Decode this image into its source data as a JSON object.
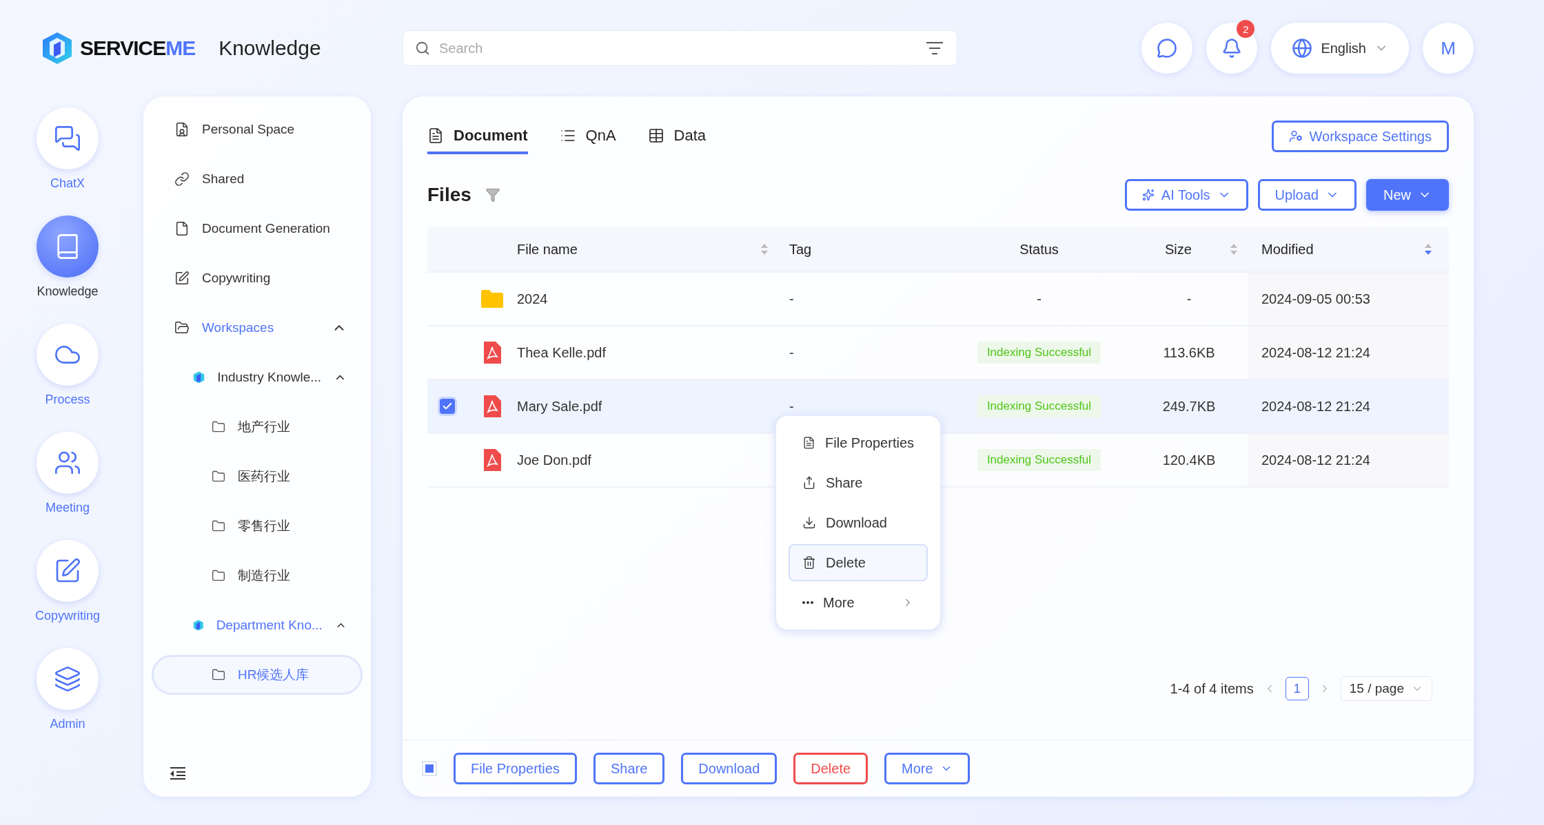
{
  "app": {
    "logo_dark": "SERVICE",
    "logo_accent": "ME",
    "title": "Knowledge"
  },
  "search": {
    "placeholder": "Search"
  },
  "header": {
    "notification_count": "2",
    "language": "English",
    "avatar_initial": "M"
  },
  "rail": [
    {
      "label": "ChatX",
      "kind": "chat",
      "selected": false
    },
    {
      "label": "Knowledge",
      "kind": "book",
      "selected": true
    },
    {
      "label": "Process",
      "kind": "cloud",
      "selected": false
    },
    {
      "label": "Meeting",
      "kind": "people",
      "selected": false
    },
    {
      "label": "Copywriting",
      "kind": "edit",
      "selected": false
    },
    {
      "label": "Admin",
      "kind": "layers",
      "selected": false
    }
  ],
  "sidebar": {
    "items": [
      {
        "label": "Personal Space",
        "kind": "personal"
      },
      {
        "label": "Shared",
        "kind": "link"
      },
      {
        "label": "Document Generation",
        "kind": "document"
      },
      {
        "label": "Copywriting",
        "kind": "edit"
      }
    ],
    "workspaces": {
      "label": "Workspaces",
      "expanded": true,
      "selected": true,
      "children": [
        {
          "label": "Industry Knowle...",
          "expanded": true,
          "selected": false,
          "children": [
            {
              "label": "地产行业",
              "selected": false
            },
            {
              "label": "医药行业",
              "selected": false
            },
            {
              "label": "零售行业",
              "selected": false
            },
            {
              "label": "制造行业",
              "selected": false
            }
          ]
        },
        {
          "label": "Department Kno...",
          "expanded": true,
          "selected": true,
          "children": [
            {
              "label": "HR候选人库",
              "selected": true
            }
          ]
        }
      ]
    }
  },
  "tabs": [
    {
      "label": "Document",
      "kind": "document",
      "selected": true
    },
    {
      "label": "QnA",
      "kind": "list",
      "selected": false
    },
    {
      "label": "Data",
      "kind": "table",
      "selected": false
    }
  ],
  "workspace_settings": "Workspace Settings",
  "files_title": "Files",
  "toolbar": [
    {
      "label": "AI Tools",
      "kind": "ai",
      "primary": false
    },
    {
      "label": "Upload",
      "kind": "plain",
      "primary": false
    },
    {
      "label": "New",
      "kind": "plain",
      "primary": true
    }
  ],
  "table": {
    "columns": [
      {
        "label": "File name",
        "sortable": true,
        "sorted": false
      },
      {
        "label": "Tag"
      },
      {
        "label": "Status"
      },
      {
        "label": "Size",
        "sortable": true,
        "sorted": false
      },
      {
        "label": "Modified",
        "sortable": true,
        "sorted": true
      }
    ],
    "rows": [
      {
        "kind": "folder",
        "name": "2024",
        "tag": "-",
        "status": "-",
        "badge": false,
        "size": "-",
        "modified": "2024-09-05 00:53",
        "selected": false
      },
      {
        "kind": "pdf",
        "name": "Thea Kelle.pdf",
        "tag": "-",
        "status": "Indexing Successful",
        "badge": true,
        "size": "113.6KB",
        "modified": "2024-08-12 21:24",
        "selected": false
      },
      {
        "kind": "pdf",
        "name": "Mary Sale.pdf",
        "tag": "-",
        "status": "Indexing Successful",
        "badge": true,
        "size": "249.7KB",
        "modified": "2024-08-12 21:24",
        "selected": true
      },
      {
        "kind": "pdf",
        "name": "Joe Don.pdf",
        "status": "Indexing Successful",
        "badge": true,
        "size": "120.4KB",
        "modified": "2024-08-12 21:24",
        "selected": false
      }
    ]
  },
  "context_menu": [
    {
      "label": "File Properties",
      "kind": "properties",
      "selected": false
    },
    {
      "label": "Share",
      "kind": "share",
      "selected": false
    },
    {
      "label": "Download",
      "kind": "download",
      "selected": false
    },
    {
      "label": "Delete",
      "kind": "delete",
      "selected": true
    },
    {
      "label": "More",
      "kind": "more",
      "selected": false
    }
  ],
  "pagination": {
    "summary": "1-4 of 4 items",
    "pages": [
      {
        "label": "1",
        "selected": true
      }
    ],
    "page_size": "15 / page"
  },
  "bulk_bar": {
    "indeterminate": true,
    "buttons": [
      {
        "label": "File Properties",
        "kind": "normal"
      },
      {
        "label": "Share",
        "kind": "normal"
      },
      {
        "label": "Download",
        "kind": "normal"
      },
      {
        "label": "Delete",
        "kind": "danger"
      },
      {
        "label": "More",
        "kind": "menu"
      }
    ]
  }
}
